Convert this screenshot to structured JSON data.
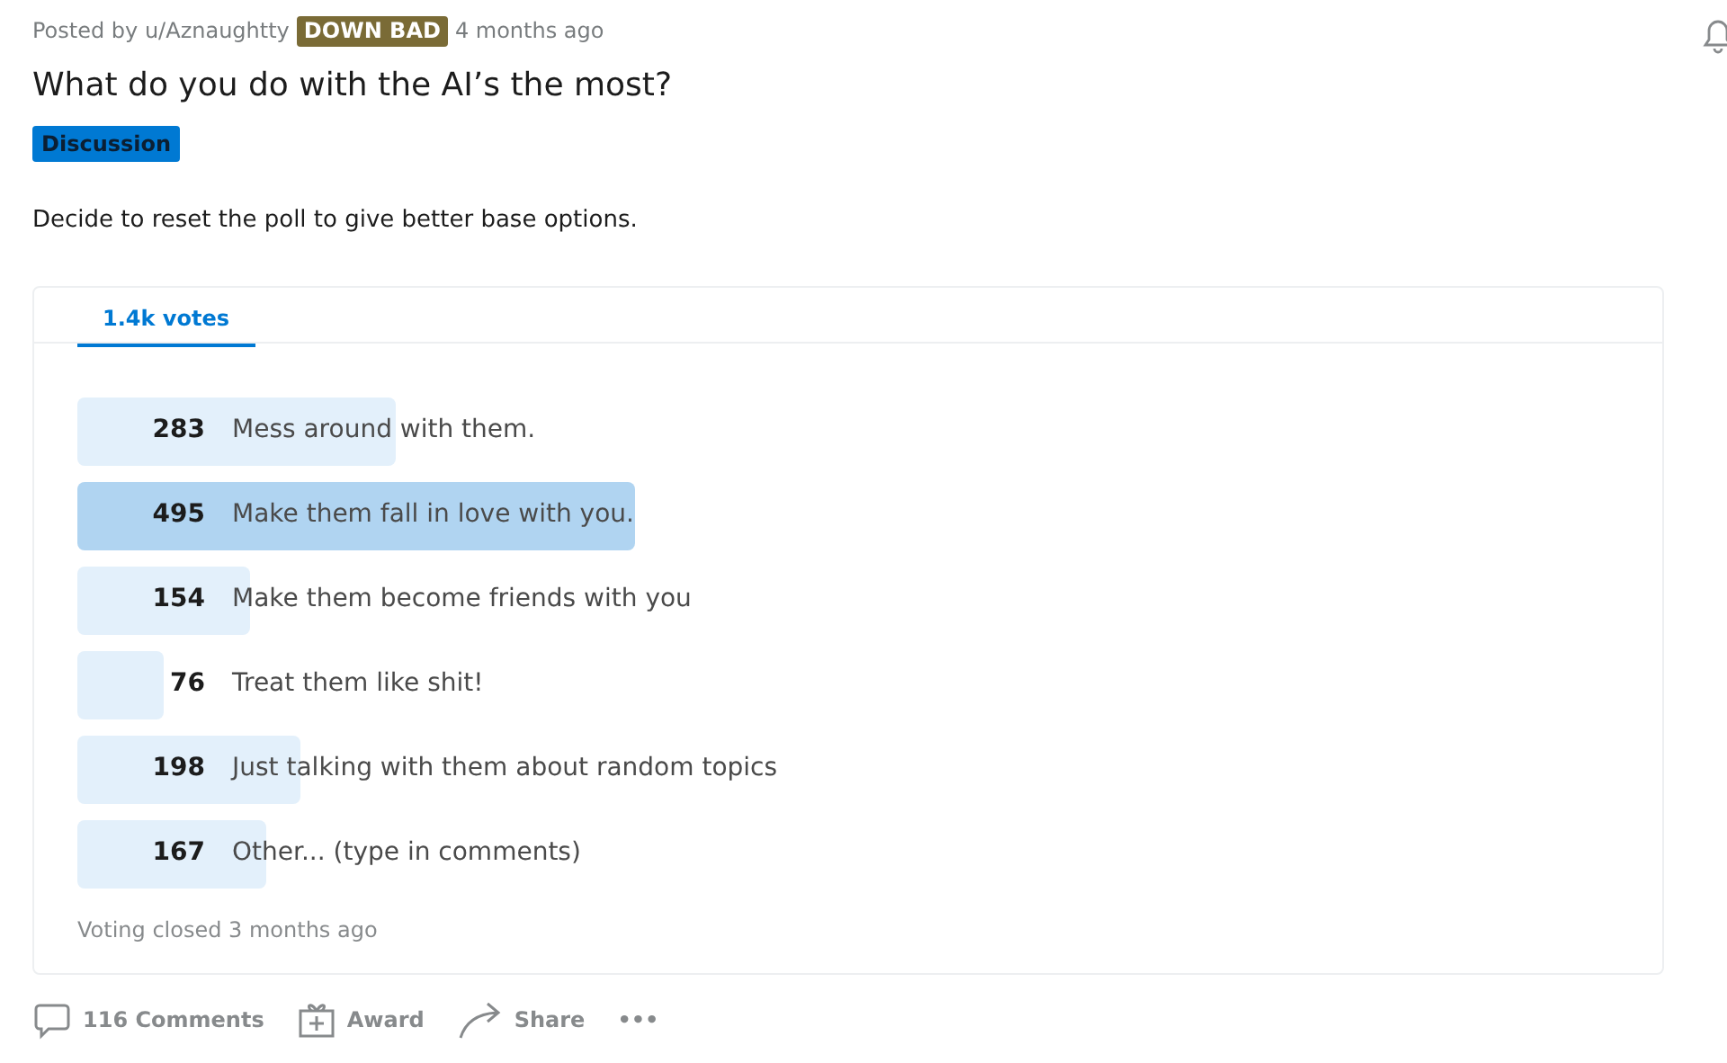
{
  "post": {
    "posted_by": "Posted by u/Aznaughtty",
    "flair_user": "DOWN BAD",
    "time": "4 months ago",
    "title": "What do you do with the AI’s the most?",
    "flair": "Discussion",
    "body": "Decide to reset the poll to give better base options."
  },
  "poll": {
    "tab": {
      "label": "1.4k votes",
      "selected": true
    },
    "options": [
      {
        "votes": "283",
        "label": "Mess around with them.",
        "winner": false
      },
      {
        "votes": "495",
        "label": "Make them fall in love with you.",
        "winner": true
      },
      {
        "votes": "154",
        "label": "Make them become friends with you",
        "winner": false
      },
      {
        "votes": "76",
        "label": "Treat them like shit!",
        "winner": false
      },
      {
        "votes": "198",
        "label": "Just talking with them about random topics",
        "winner": false
      },
      {
        "votes": "167",
        "label": "Other... (type in comments)",
        "winner": false
      }
    ],
    "status": "Voting closed 3 months ago"
  },
  "actions": [
    {
      "kind": "comments",
      "label": "116 Comments"
    },
    {
      "kind": "award",
      "label": "Award"
    },
    {
      "kind": "share",
      "label": "Share"
    },
    {
      "kind": "more",
      "label": "•••"
    }
  ]
}
